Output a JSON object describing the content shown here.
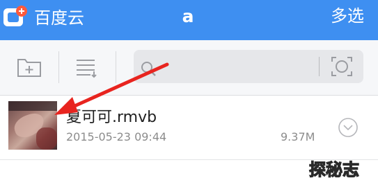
{
  "navbar": {
    "back_label": "百度云",
    "title": "a",
    "select_label": "多选",
    "color": "#3e8ff1"
  },
  "toolbar": {
    "new_folder_icon": "folder-plus-icon",
    "sort_icon": "list-sort-icon"
  },
  "search": {
    "placeholder": "",
    "value": "",
    "icon": "search-icon",
    "scan_icon": "scan-icon"
  },
  "files": [
    {
      "name": "夏可可.rmvb",
      "date": "2015-05-23 09:44",
      "size": "9.37M",
      "expand_icon": "chevron-down-circle-icon"
    }
  ],
  "annotation": {
    "type": "arrow",
    "color": "#e8241f"
  },
  "watermark": {
    "text": "探秘志"
  }
}
